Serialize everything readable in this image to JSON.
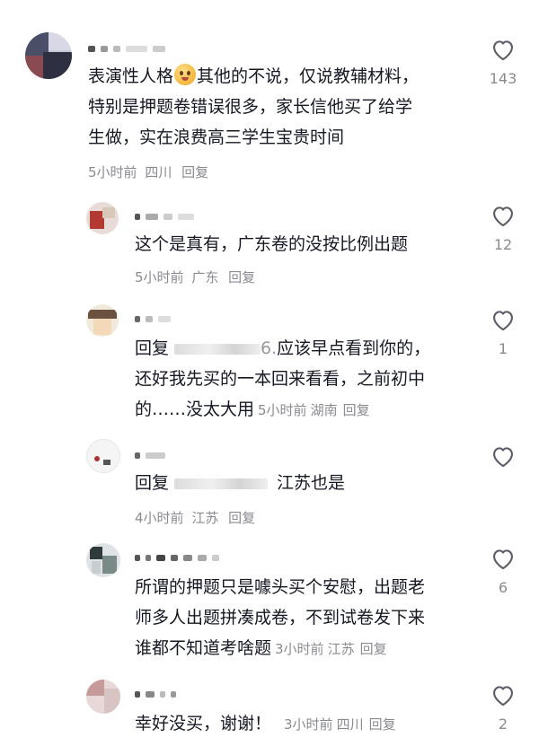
{
  "comments": [
    {
      "text_lines": [
        "表演性人格",
        "其他的不说，仅说教辅材料，",
        "特别是押题卷错误很多，家长信他买了给学",
        "生做，实在浪费高三学生宝贵时间"
      ],
      "emoji": "smiling-face-emoji",
      "time": "5小时前",
      "region": "四川",
      "reply": "回复",
      "likes": "143"
    },
    {
      "text_lines": [
        "这个是真有，广东卷的没按比例出题"
      ],
      "time": "5小时前",
      "region": "广东",
      "reply": "回复",
      "likes": "12"
    },
    {
      "reply_prefix": "回复",
      "mention_tail": "6.",
      "text_lines": [
        "应该早点看到你的，",
        "还好我先买的一本回来看看，之前初中",
        "的……没太大用"
      ],
      "time": "5小时前",
      "region": "湖南",
      "reply": "回复",
      "likes": "1"
    },
    {
      "reply_prefix": "回复",
      "text_lines": [
        "江苏也是"
      ],
      "time": "4小时前",
      "region": "江苏",
      "reply": "回复",
      "likes": ""
    },
    {
      "text_lines": [
        "所谓的押题只是噱头买个安慰，出题老",
        "师多人出题拼凑成卷，不到试卷发下来",
        "谁都不知道考啥题"
      ],
      "time": "3小时前",
      "region": "江苏",
      "reply": "回复",
      "likes": "6"
    },
    {
      "text_lines": [
        "幸好没买，谢谢！"
      ],
      "time": "3小时前",
      "region": "四川",
      "reply": "回复",
      "likes": "2"
    }
  ],
  "icons": {
    "like": "heart-outline-icon"
  },
  "colors": {
    "text": "#161823",
    "meta": "#8a8b91",
    "heart": "#5c5c66"
  }
}
